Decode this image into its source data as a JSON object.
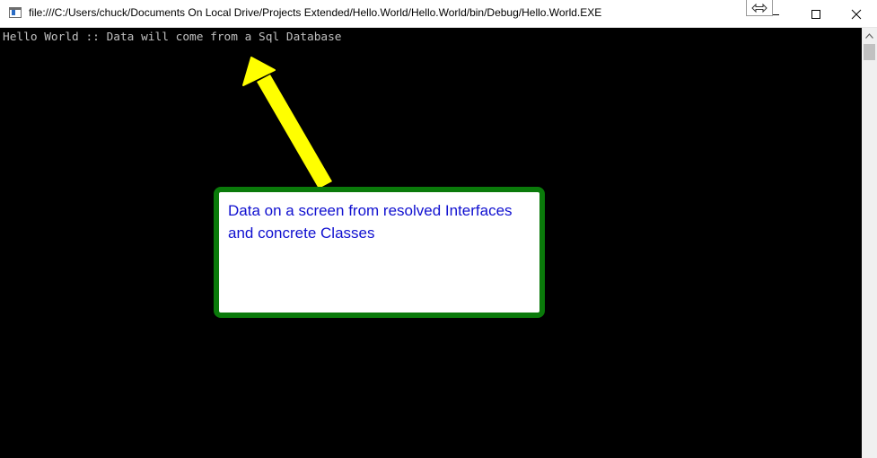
{
  "window": {
    "title": "file:///C:/Users/chuck/Documents On Local Drive/Projects Extended/Hello.World/Hello.World/bin/Debug/Hello.World.EXE",
    "controls": {
      "minimize_icon": "minimize-icon",
      "maximize_icon": "maximize-icon",
      "close_icon": "close-icon",
      "resize_icon": "resize-icon"
    }
  },
  "console": {
    "output_line": "Hello World :: Data will come from a Sql Database",
    "background_color": "#000000",
    "text_color": "#c0c0c0"
  },
  "annotation": {
    "callout_text": "Data on a screen from resolved Interfaces and concrete Classes",
    "arrow_color": "#ffff00",
    "border_color": "#0a7a0a",
    "text_color": "#1010d0"
  }
}
